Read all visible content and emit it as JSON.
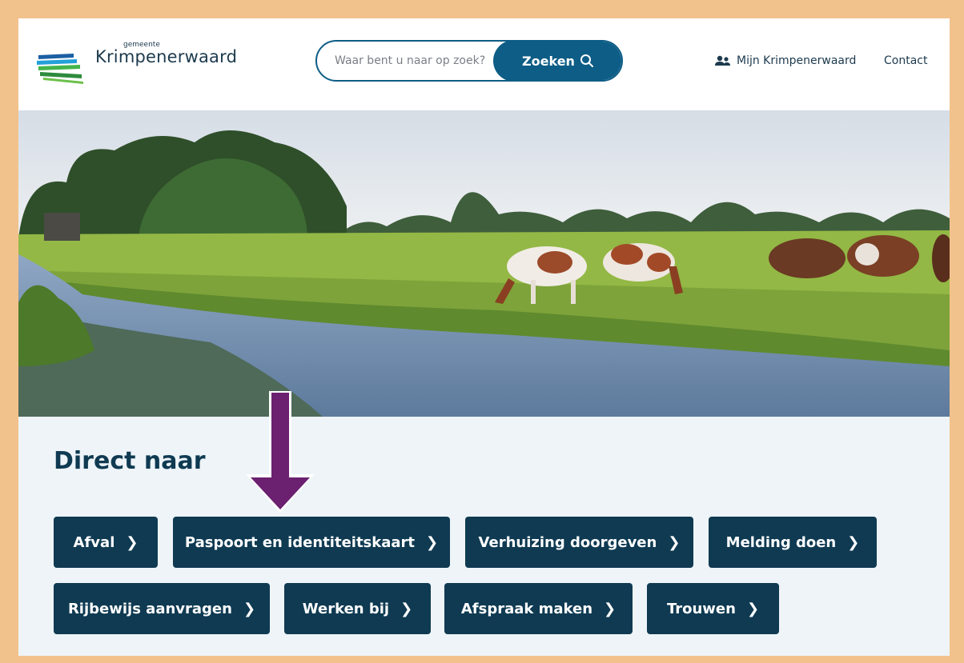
{
  "header": {
    "logo": {
      "small": "gemeente",
      "big": "Krimpenerwaard"
    },
    "search": {
      "placeholder": "Waar bent u naar op zoek?",
      "button": "Zoeken"
    },
    "nav": {
      "mijn": "Mijn Krimpenerwaard",
      "contact": "Contact"
    }
  },
  "direct": {
    "title": "Direct naar",
    "buttons": [
      "Afval",
      "Paspoort en identiteitskaart",
      "Verhuizing doorgeven",
      "Melding doen",
      "Rijbewijs aanvragen",
      "Werken bij",
      "Afspraak maken",
      "Trouwen"
    ]
  },
  "colors": {
    "frame": "#f2c28c",
    "primary": "#0d5d86",
    "dark": "#0f3a52",
    "annotation_arrow": "#6b2070"
  }
}
